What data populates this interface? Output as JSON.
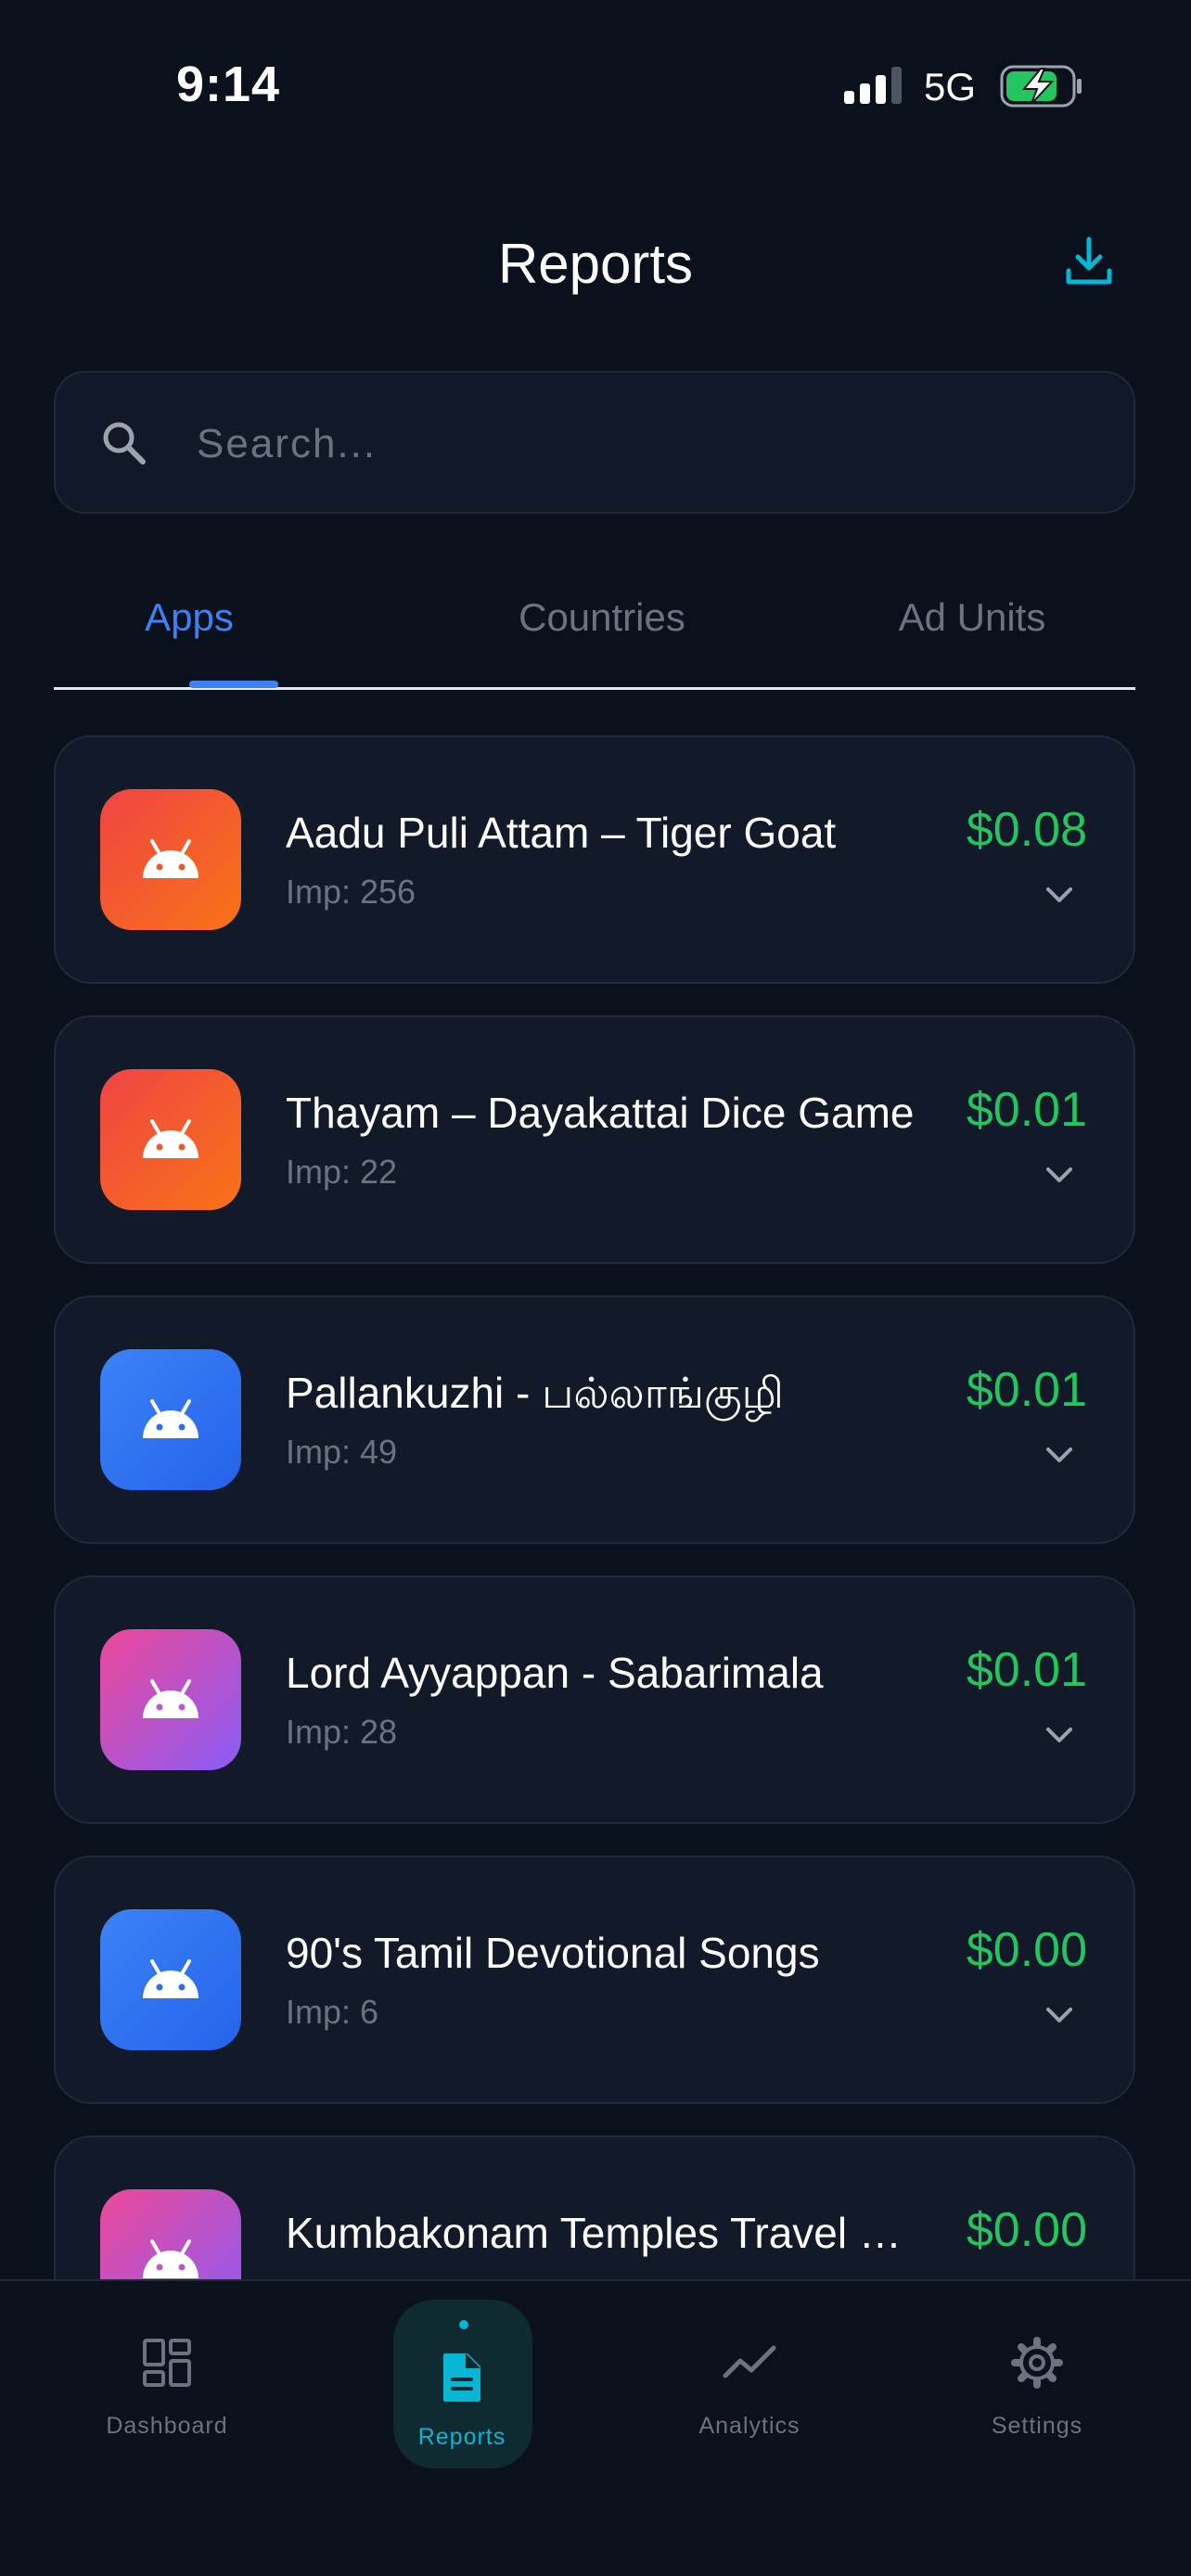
{
  "status_bar": {
    "time": "9:14",
    "network": "5G"
  },
  "header": {
    "title": "Reports"
  },
  "search": {
    "placeholder": "Search..."
  },
  "tabs": [
    {
      "label": "Apps",
      "active": true
    },
    {
      "label": "Countries",
      "active": false
    },
    {
      "label": "Ad Units",
      "active": false
    }
  ],
  "apps": [
    {
      "name": "Aadu Puli Attam – Tiger Goat",
      "impressions": "Imp: 256",
      "revenue": "$0.08",
      "icon_color": "orange",
      "icon": "android-icon"
    },
    {
      "name": "Thayam – Dayakattai Dice Game",
      "impressions": "Imp: 22",
      "revenue": "$0.01",
      "icon_color": "orange",
      "icon": "android-icon"
    },
    {
      "name": "Pallankuzhi - பல்லாங்குழி",
      "impressions": "Imp: 49",
      "revenue": "$0.01",
      "icon_color": "blue",
      "icon": "android-icon"
    },
    {
      "name": "Lord Ayyappan - Sabarimala",
      "impressions": "Imp: 28",
      "revenue": "$0.01",
      "icon_color": "pink",
      "icon": "android-icon"
    },
    {
      "name": "90's Tamil Devotional Songs",
      "impressions": "Imp: 6",
      "revenue": "$0.00",
      "icon_color": "blue",
      "icon": "android-icon"
    },
    {
      "name": "Kumbakonam Temples Travel Guide",
      "impressions": "",
      "revenue": "$0.00",
      "icon_color": "pink",
      "icon": "android-icon"
    }
  ],
  "bottom_nav": [
    {
      "label": "Dashboard",
      "icon": "dashboard-icon",
      "active": false
    },
    {
      "label": "Reports",
      "icon": "document-icon",
      "active": true
    },
    {
      "label": "Analytics",
      "icon": "trend-line-icon",
      "active": false
    },
    {
      "label": "Settings",
      "icon": "gear-icon",
      "active": false
    }
  ],
  "colors": {
    "background": "#0b111c",
    "card": "#121a2a",
    "accent_blue": "#3b82f6",
    "accent_cyan": "#06b6d4",
    "revenue_green": "#22c55e",
    "muted": "#6b7280"
  }
}
